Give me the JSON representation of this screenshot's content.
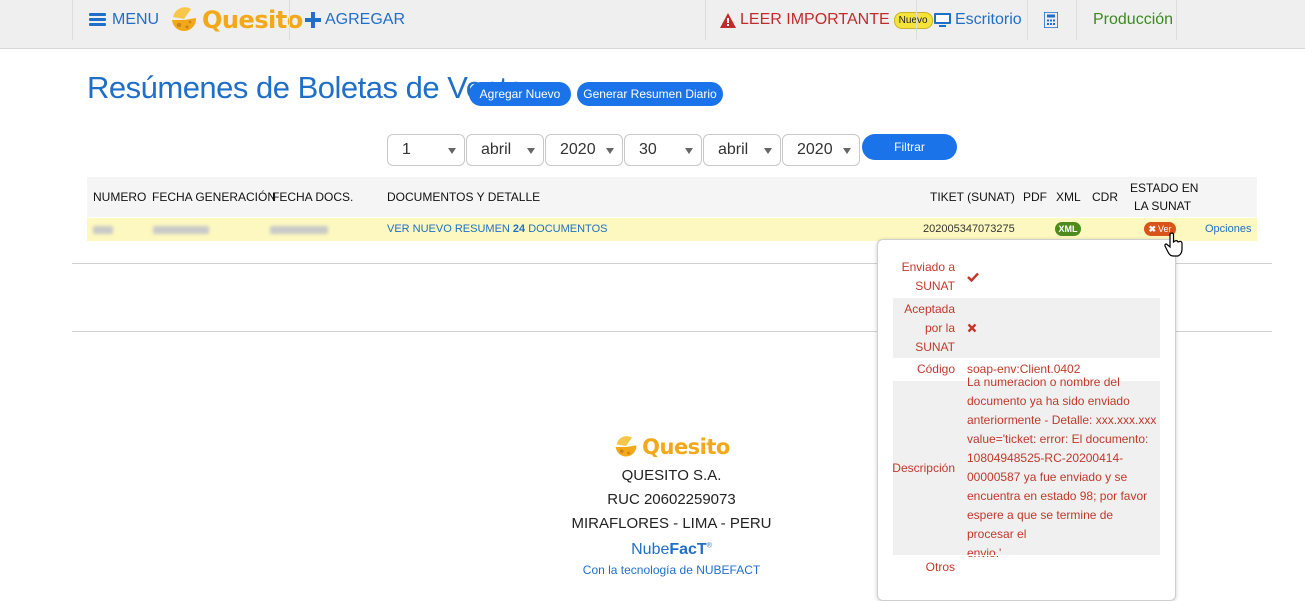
{
  "topbar": {
    "menu_label": "MENU",
    "brand": "Quesito",
    "add_label": "AGREGAR",
    "important_label": "LEER IMPORTANTE",
    "important_badge": "Nuevo",
    "desktop_label": "Escritorio",
    "production_label": "Producción",
    "icons": {
      "menu": "hamburger-icon",
      "add": "plus-icon",
      "warning": "warning-icon",
      "desktop": "monitor-icon",
      "calc": "calculator-icon"
    }
  },
  "page": {
    "title": "Resúmenes de Boletas de Venta",
    "btn_add_new": "Agregar Nuevo",
    "btn_daily_summary": "Generar Resumen Diario"
  },
  "filter": {
    "day_from": "1",
    "month_from": "abril",
    "year_from": "2020",
    "day_to": "30",
    "month_to": "abril",
    "year_to": "2020",
    "button": "Filtrar"
  },
  "table": {
    "headers": {
      "numero": "NUMERO",
      "fecha_generacion": "FECHA GENERACIÓN",
      "fecha_docs": "FECHA DOCS.",
      "documentos": "DOCUMENTOS Y DETALLE",
      "tiket": "TIKET (SUNAT)",
      "pdf": "PDF",
      "xml": "XML",
      "cdr": "CDR",
      "estado_line1": "ESTADO EN",
      "estado_line2": "LA SUNAT"
    },
    "row": {
      "ver_prefix": "VER NUEVO RESUMEN ",
      "doc_count": "24",
      "ver_suffix": " DOCUMENTOS",
      "tiket": "202005347073275",
      "xml_badge": "XML",
      "estado_badge": "Ver",
      "opciones": "Opciones"
    }
  },
  "popover": {
    "enviado_label_1": "Enviado a",
    "enviado_label_2": "SUNAT",
    "aceptada_label_1": "Aceptada",
    "aceptada_label_2": "por la",
    "aceptada_label_3": "SUNAT",
    "codigo_label": "Código",
    "codigo_value": "soap-env:Client.0402",
    "descripcion_label": "Descripción",
    "descripcion_lines": [
      "La numeracion o nombre del",
      "documento ya ha sido enviado",
      "anteriormente - Detalle: xxx.xxx.xxx",
      "value='ticket: error: El documento:",
      "10804948525-RC-20200414-",
      "00000587 ya fue enviado y se",
      "encuentra en estado 98; por favor",
      "espere a que se termine de procesar el",
      "envio.'"
    ],
    "otros_label": "Otros"
  },
  "footer": {
    "brand": "Quesito",
    "company": "QUESITO S.A.",
    "ruc": "RUC 20602259073",
    "location": "MIRAFLORES - LIMA - PERU",
    "nubefact_a": "Nube",
    "nubefact_b": "FacT",
    "powered": "Con la tecnología de NUBEFACT"
  },
  "colors": {
    "accent": "#1f6fc9",
    "button": "#1a73e8",
    "brand": "#f3a81a",
    "error": "#c0392b",
    "row_highlight": "#fcf8bf"
  }
}
